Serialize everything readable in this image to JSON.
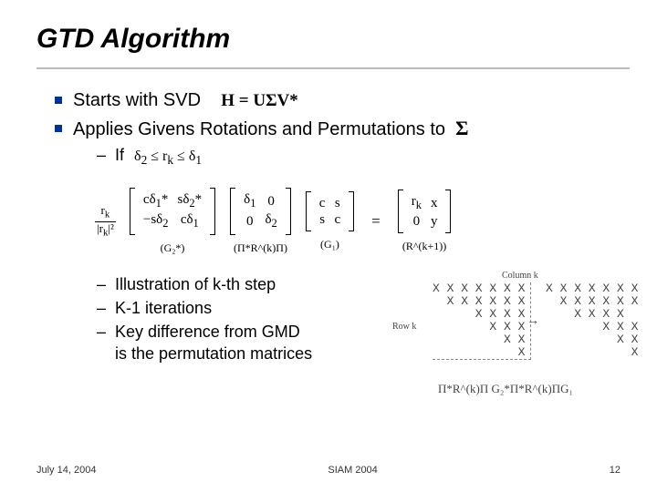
{
  "title": "GTD Algorithm",
  "bullets": {
    "b1": "Starts with SVD",
    "b1_math": "H = UΣV*",
    "b2": "Applies Givens Rotations and Permutations to",
    "b2_sigma": "Σ",
    "if_label": "If",
    "if_math": "δ₂ ≤ r_k ≤ δ₁"
  },
  "matrix_eq": {
    "m1_frac_num": "r_k",
    "m1_frac_den": "|r_k|²",
    "m1": [
      [
        "cδ₁*",
        "sδ₂*"
      ],
      [
        "−sδ₂",
        "cδ₁"
      ]
    ],
    "m1_label": "(G₂*)",
    "m2": [
      [
        "δ₁",
        "0"
      ],
      [
        "0",
        "δ₂"
      ]
    ],
    "m2_label": "(Π*R^(k)Π)",
    "m3": [
      [
        "c"
      ],
      [
        "s"
      ]
    ],
    "m3b": [
      [
        "s"
      ],
      [
        "c"
      ]
    ],
    "m3_label": "(G₁)",
    "rhs": [
      [
        "r_k",
        "x"
      ],
      [
        "0",
        "y"
      ]
    ],
    "rhs_label": "(R^(k+1))"
  },
  "sublist": {
    "s1": "Illustration of k-th step",
    "s2": "K-1 iterations",
    "s3a": "Key difference from GMD",
    "s3b": "is the permutation matrices"
  },
  "diagram": {
    "col_label": "Column k",
    "row_label": "Row k",
    "big_text": "X X X X X X X\n  X X X X X X\n      X X X X\n        X X X\n          X X\n            X",
    "small_text": "X X X X X X X\n  X X X X X X\n    X X X X\n        X X X\n          X X\n            X",
    "bottom_formula": "Π*R^(k)Π          G₂*Π*R^(k)ΠG₁"
  },
  "footer": {
    "date": "July 14, 2004",
    "venue": "SIAM 2004",
    "page": "12"
  }
}
